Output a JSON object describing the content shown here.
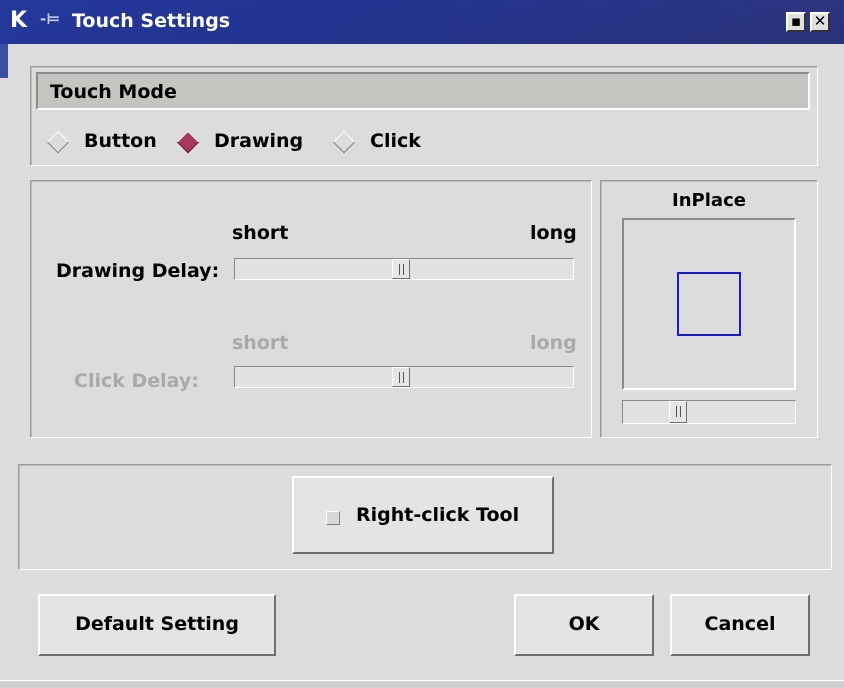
{
  "window": {
    "app_glyph": "K",
    "pin_glyph": "-⊨",
    "title": "Touch Settings",
    "minimize_glyph": "▪",
    "close_glyph": "✕"
  },
  "touch_mode": {
    "header": "Touch Mode",
    "options": [
      {
        "label": "Button",
        "selected": false
      },
      {
        "label": "Drawing",
        "selected": true
      },
      {
        "label": "Click",
        "selected": false
      }
    ]
  },
  "drawing_delay": {
    "label": "Drawing Delay:",
    "min_label": "short",
    "max_label": "long",
    "value_fraction": 0.49,
    "enabled": true
  },
  "click_delay": {
    "label": "Click Delay:",
    "min_label": "short",
    "max_label": "long",
    "value_fraction": 0.49,
    "enabled": false
  },
  "inplace": {
    "title": "InPlace",
    "slider_fraction": 0.3,
    "square_color": "#1a1acc"
  },
  "right_click_tool": {
    "label": "Right-click Tool",
    "checked": false
  },
  "buttons": {
    "default": "Default Setting",
    "ok": "OK",
    "cancel": "Cancel"
  },
  "colors": {
    "title_bar": "#3a55b5",
    "radio_selected": "#a8395d",
    "background": "#dcdcdc"
  }
}
